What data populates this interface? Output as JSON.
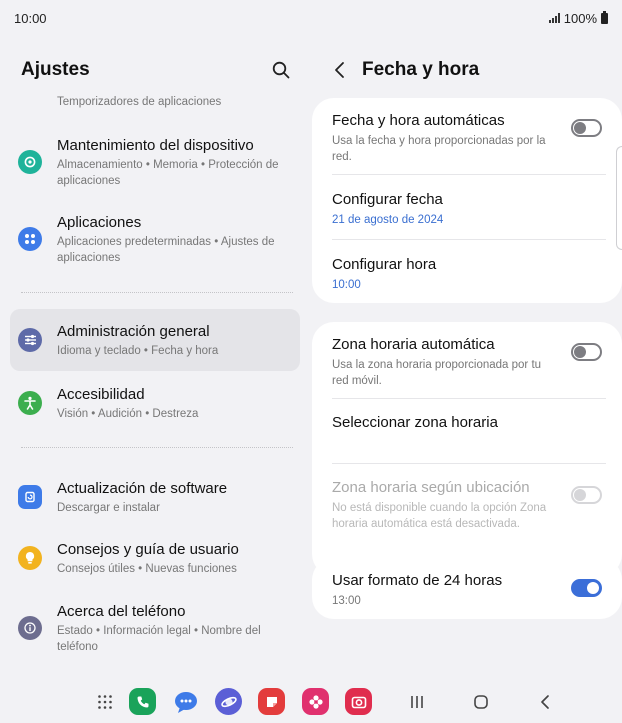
{
  "status_bar": {
    "time": "10:00",
    "battery": "100%"
  },
  "left": {
    "title": "Ajustes",
    "partial_item_sub": "Temporizadores de aplicaciones",
    "items": [
      {
        "label": "Mantenimiento del dispositivo",
        "sub": "Almacenamiento  •  Memoria  •  Protección de aplicaciones",
        "icon": "device-care-icon",
        "color": "#1fb39a"
      },
      {
        "label": "Aplicaciones",
        "sub": "Aplicaciones predeterminadas  •  Ajustes de aplicaciones",
        "icon": "apps-icon",
        "color": "#3e7be8"
      },
      {
        "label": "Administración general",
        "sub": "Idioma y teclado  •  Fecha y hora",
        "icon": "sliders-icon",
        "color": "#5e6aa8"
      },
      {
        "label": "Accesibilidad",
        "sub": "Visión  •  Audición  •  Destreza",
        "icon": "accessibility-icon",
        "color": "#3cae4e"
      },
      {
        "label": "Actualización de software",
        "sub": "Descargar e instalar",
        "icon": "software-update-icon",
        "color": "#3e7be8"
      },
      {
        "label": "Consejos y guía de usuario",
        "sub": "Consejos útiles  •  Nuevas funciones",
        "icon": "lightbulb-icon",
        "color": "#f2b31f"
      },
      {
        "label": "Acerca del teléfono",
        "sub": "Estado  •  Información legal  •  Nombre del teléfono",
        "icon": "info-icon",
        "color": "#6d6d8f"
      }
    ]
  },
  "right": {
    "title": "Fecha y hora",
    "auto_datetime": {
      "label": "Fecha y hora automáticas",
      "sub": "Usa la fecha y hora proporcionadas por la red.",
      "state": "off"
    },
    "set_date": {
      "label": "Configurar fecha",
      "value": "21 de agosto de 2024"
    },
    "set_time": {
      "label": "Configurar hora",
      "value": "10:00"
    },
    "auto_timezone": {
      "label": "Zona horaria automática",
      "sub": "Usa la zona horaria proporcionada por tu red móvil.",
      "state": "off"
    },
    "select_timezone": {
      "label": "Seleccionar zona horaria"
    },
    "location_timezone": {
      "label": "Zona horaria según ubicación",
      "sub": "No está disponible cuando la opción Zona horaria automática está desactivada.",
      "state": "disabled"
    },
    "format_24h": {
      "label": "Usar formato de 24 horas",
      "sub": "13:00",
      "state": "on"
    }
  },
  "colors": {
    "accent": "#3b6ed8",
    "background": "#f2f2f5",
    "card": "#ffffff"
  },
  "dock": [
    {
      "name": "apps-grid-icon"
    },
    {
      "name": "phone-icon",
      "color": "#1aa35a"
    },
    {
      "name": "messages-icon",
      "color": "#3e7be8"
    },
    {
      "name": "internet-icon",
      "color": "#5b5fd6"
    },
    {
      "name": "notes-icon",
      "color": "#e33c3c"
    },
    {
      "name": "gallery-icon",
      "color": "#e0306e"
    },
    {
      "name": "camera-icon",
      "color": "#e02d4e"
    }
  ]
}
